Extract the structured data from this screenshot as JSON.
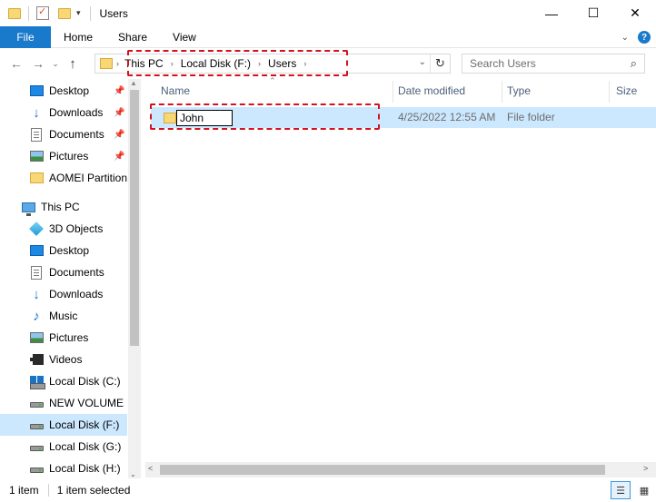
{
  "window": {
    "title": "Users",
    "minimize_glyph": "—",
    "maximize_glyph": "☐",
    "close_glyph": "✕",
    "qa_dropdown_glyph": "▾"
  },
  "ribbon": {
    "tabs": [
      "File",
      "Home",
      "Share",
      "View"
    ],
    "expand_glyph": "⌄",
    "help_glyph": "?"
  },
  "nav": {
    "back_glyph": "←",
    "forward_glyph": "→",
    "recent_glyph": "⌄",
    "up_glyph": "↑",
    "breadcrumb": [
      "This PC",
      "Local Disk (F:)",
      "Users"
    ],
    "crumb_sep_glyph": "›",
    "dropdown_glyph": "⌄",
    "refresh_glyph": "↻",
    "search_placeholder": "Search Users",
    "search_glyph": "⌕"
  },
  "sidebar": {
    "quick_access": [
      {
        "label": "Desktop",
        "icon": "desktop-icon",
        "pinned": true
      },
      {
        "label": "Downloads",
        "icon": "downloads-icon",
        "pinned": true
      },
      {
        "label": "Documents",
        "icon": "documents-icon",
        "pinned": true
      },
      {
        "label": "Pictures",
        "icon": "pictures-icon",
        "pinned": true
      },
      {
        "label": "AOMEI Partition",
        "icon": "folder-icon",
        "pinned": false
      }
    ],
    "pin_glyph": "📌",
    "this_pc": {
      "label": "This PC",
      "icon": "this-pc-icon"
    },
    "this_pc_items": [
      {
        "label": "3D Objects",
        "icon": "3d-objects-icon"
      },
      {
        "label": "Desktop",
        "icon": "desktop-icon"
      },
      {
        "label": "Documents",
        "icon": "documents-icon"
      },
      {
        "label": "Downloads",
        "icon": "downloads-icon"
      },
      {
        "label": "Music",
        "icon": "music-icon"
      },
      {
        "label": "Pictures",
        "icon": "pictures-icon"
      },
      {
        "label": "Videos",
        "icon": "videos-icon"
      },
      {
        "label": "Local Disk (C:)",
        "icon": "windows-drive-icon"
      },
      {
        "label": "NEW VOLUME (E",
        "icon": "drive-icon"
      },
      {
        "label": "Local Disk (F:)",
        "icon": "drive-icon",
        "selected": true
      },
      {
        "label": "Local Disk (G:)",
        "icon": "drive-icon"
      },
      {
        "label": "Local Disk (H:)",
        "icon": "drive-icon"
      }
    ],
    "scroll_up_glyph": "▲",
    "scroll_down_glyph": "⌄"
  },
  "columns": {
    "sort_glyph": "⌃",
    "headers": [
      "Name",
      "Date modified",
      "Type",
      "Size"
    ]
  },
  "files": [
    {
      "name": "John",
      "date_modified": "4/25/2022 12:55 AM",
      "type": "File folder",
      "renaming": true
    }
  ],
  "hscroll": {
    "left_glyph": "<",
    "right_glyph": ">"
  },
  "status": {
    "item_count": "1 item",
    "selected": "1 item selected",
    "details_view_glyph": "☰",
    "icons_view_glyph": "▦"
  },
  "colors": {
    "accent": "#1979ca",
    "selection": "#cce8ff",
    "highlight": "#d4121e"
  }
}
